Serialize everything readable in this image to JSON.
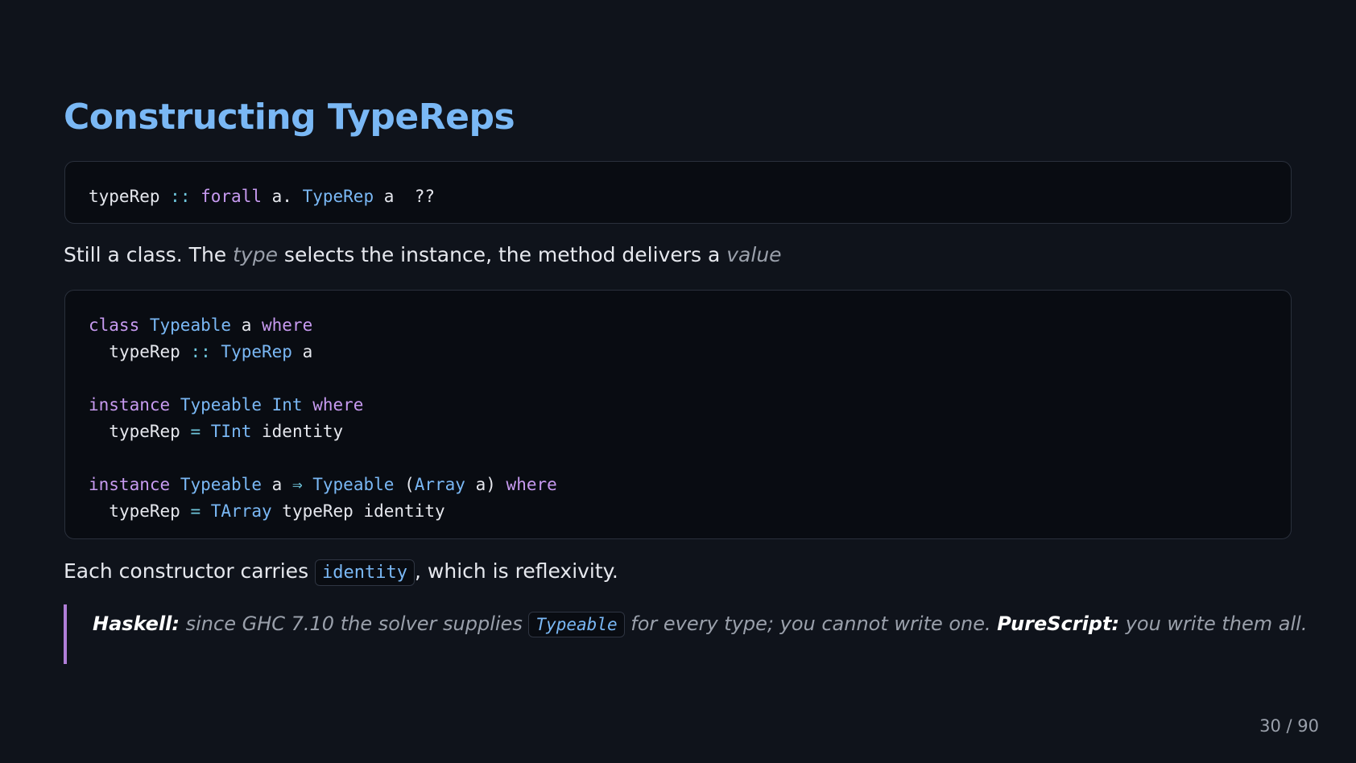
{
  "slide": {
    "title": "Constructing TypeReps",
    "code1": {
      "tokens": [
        "typeRep",
        "::",
        "forall",
        "a.",
        "TypeRep",
        "a",
        "??"
      ]
    },
    "para1": {
      "pre": "Still a class. The ",
      "em1": "type",
      "mid": " selects the instance, the method delivers a ",
      "em2": "value"
    },
    "code2": {
      "l1": [
        "class",
        "Typeable",
        "a",
        "where"
      ],
      "l2": [
        "typeRep",
        "::",
        "TypeRep",
        "a"
      ],
      "l3": [
        "instance",
        "Typeable",
        "Int",
        "where"
      ],
      "l4": [
        "typeRep",
        "=",
        "TInt",
        "identity"
      ],
      "l5": [
        "instance",
        "Typeable",
        "a",
        "⇒",
        "Typeable",
        "(",
        "Array",
        "a)",
        "where"
      ],
      "l6": [
        "typeRep",
        "=",
        "TArray",
        "typeRep",
        "identity"
      ]
    },
    "para2": {
      "pre": "Each constructor carries ",
      "code": "identity",
      "post": ", which is reflexivity."
    },
    "quote": {
      "b1": "Haskell:",
      "t1": " since GHC 7.10 the solver supplies ",
      "code": "Typeable",
      "t2": " for every type; you cannot write one. ",
      "b2": "PureScript:",
      "t3": " you write them all."
    },
    "page_number": "30 / 90"
  },
  "colors": {
    "background": "#0f131b",
    "title": "#7ab8f5",
    "keyword": "#c79af0",
    "type": "#7ab8f5",
    "operator": "#6fc6dc",
    "muted": "#9aa0ab",
    "quote_bar": "#b07ed8"
  }
}
